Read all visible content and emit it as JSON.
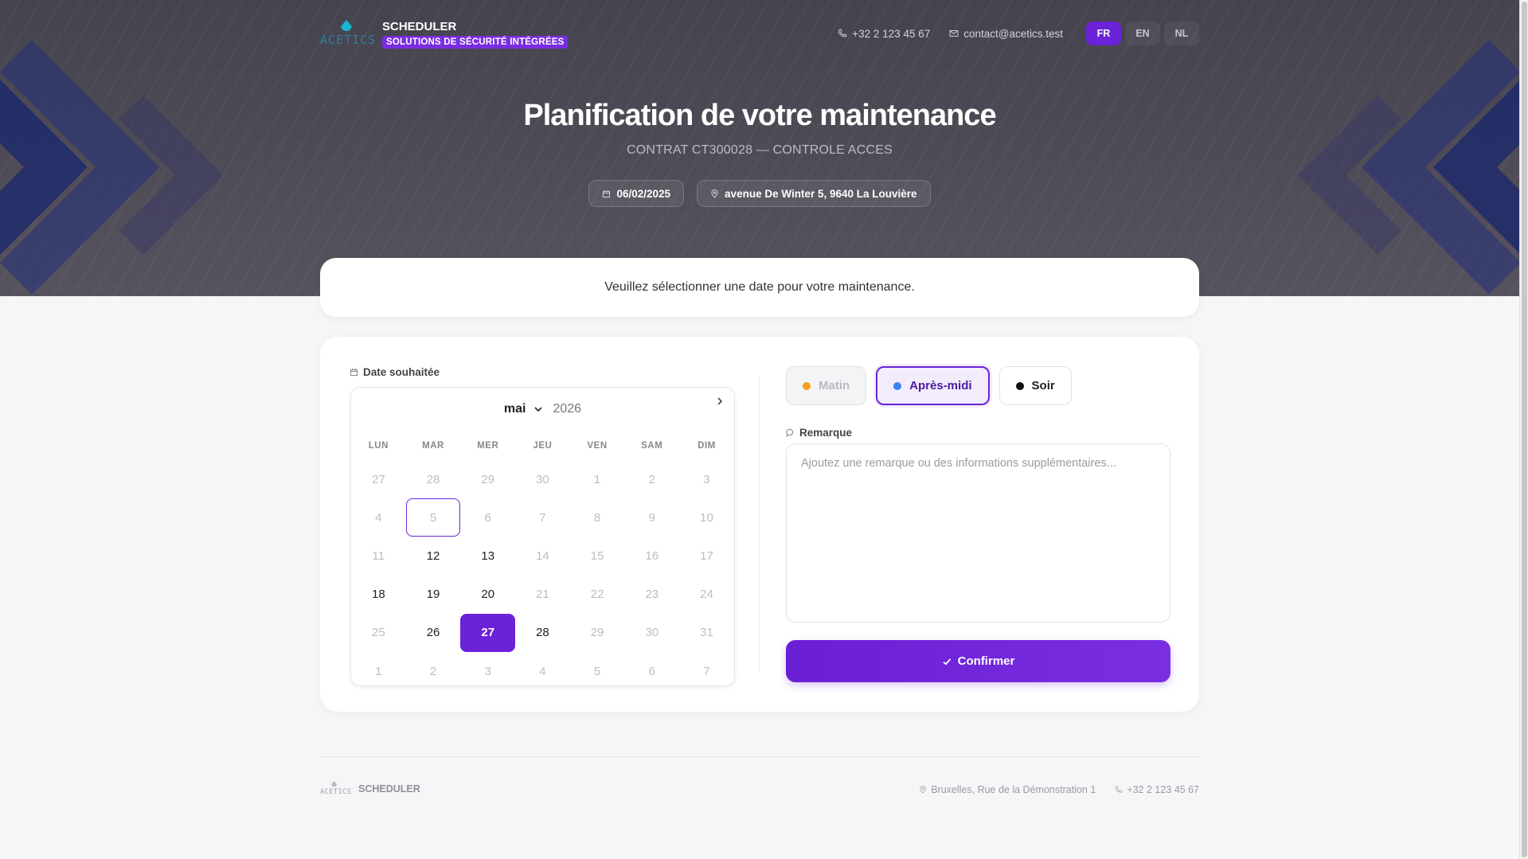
{
  "header": {
    "logo_word": "ACETICS",
    "app_name": "SCHEDULER",
    "tagline": "SOLUTIONS DE SÉCURITÉ INTÉGRÉES",
    "phone": "+32 2 123 45 67",
    "email": "contact@acetics.test",
    "languages": [
      "FR",
      "EN",
      "NL"
    ],
    "active_language": "FR"
  },
  "hero": {
    "title": "Planification de votre maintenance",
    "subtitle": "CONTRAT CT300028 — CONTROLE ACCES",
    "date": "06/02/2025",
    "address": "avenue De Winter 5, 9640 La Louvière"
  },
  "notice": "Veuillez sélectionner une date pour votre maintenance.",
  "calendar": {
    "label": "Date souhaitée",
    "month": "mai",
    "year": "2026",
    "weekdays": [
      "LUN",
      "MAR",
      "MER",
      "JEU",
      "VEN",
      "SAM",
      "DIM"
    ],
    "days": [
      {
        "d": "27",
        "s": "off"
      },
      {
        "d": "28",
        "s": "off"
      },
      {
        "d": "29",
        "s": "off"
      },
      {
        "d": "30",
        "s": "off"
      },
      {
        "d": "1",
        "s": "off"
      },
      {
        "d": "2",
        "s": "off"
      },
      {
        "d": "3",
        "s": "off"
      },
      {
        "d": "4",
        "s": "off"
      },
      {
        "d": "5",
        "s": "today"
      },
      {
        "d": "6",
        "s": "off"
      },
      {
        "d": "7",
        "s": "off"
      },
      {
        "d": "8",
        "s": "off"
      },
      {
        "d": "9",
        "s": "off"
      },
      {
        "d": "10",
        "s": "off"
      },
      {
        "d": "11",
        "s": "off"
      },
      {
        "d": "12",
        "s": "on"
      },
      {
        "d": "13",
        "s": "on"
      },
      {
        "d": "14",
        "s": "off"
      },
      {
        "d": "15",
        "s": "off"
      },
      {
        "d": "16",
        "s": "off"
      },
      {
        "d": "17",
        "s": "off"
      },
      {
        "d": "18",
        "s": "on"
      },
      {
        "d": "19",
        "s": "on"
      },
      {
        "d": "20",
        "s": "on"
      },
      {
        "d": "21",
        "s": "off"
      },
      {
        "d": "22",
        "s": "off"
      },
      {
        "d": "23",
        "s": "off"
      },
      {
        "d": "24",
        "s": "off"
      },
      {
        "d": "25",
        "s": "off"
      },
      {
        "d": "26",
        "s": "on"
      },
      {
        "d": "27",
        "s": "sel"
      },
      {
        "d": "28",
        "s": "on"
      },
      {
        "d": "29",
        "s": "off"
      },
      {
        "d": "30",
        "s": "off"
      },
      {
        "d": "31",
        "s": "off"
      },
      {
        "d": "1",
        "s": "off"
      },
      {
        "d": "2",
        "s": "off"
      },
      {
        "d": "3",
        "s": "off"
      },
      {
        "d": "4",
        "s": "off"
      },
      {
        "d": "5",
        "s": "off"
      },
      {
        "d": "6",
        "s": "off"
      },
      {
        "d": "7",
        "s": "off"
      }
    ]
  },
  "slots": [
    {
      "label": "Matin",
      "color": "#f5a01a",
      "state": "disabled"
    },
    {
      "label": "Après-midi",
      "color": "#3b82f6",
      "state": "active"
    },
    {
      "label": "Soir",
      "color": "#111111",
      "state": "normal"
    }
  ],
  "remark": {
    "label": "Remarque",
    "placeholder": "Ajoutez une remarque ou des informations supplémentaires..."
  },
  "confirm_label": "Confirmer",
  "footer": {
    "logo_word": "ACETICS",
    "app_name": "SCHEDULER",
    "address": "Bruxelles, Rue de la Démonstration 1",
    "phone": "+32 2 123 45 67"
  },
  "colors": {
    "accent": "#6b22d8",
    "hero_bg": "#4a4752"
  }
}
